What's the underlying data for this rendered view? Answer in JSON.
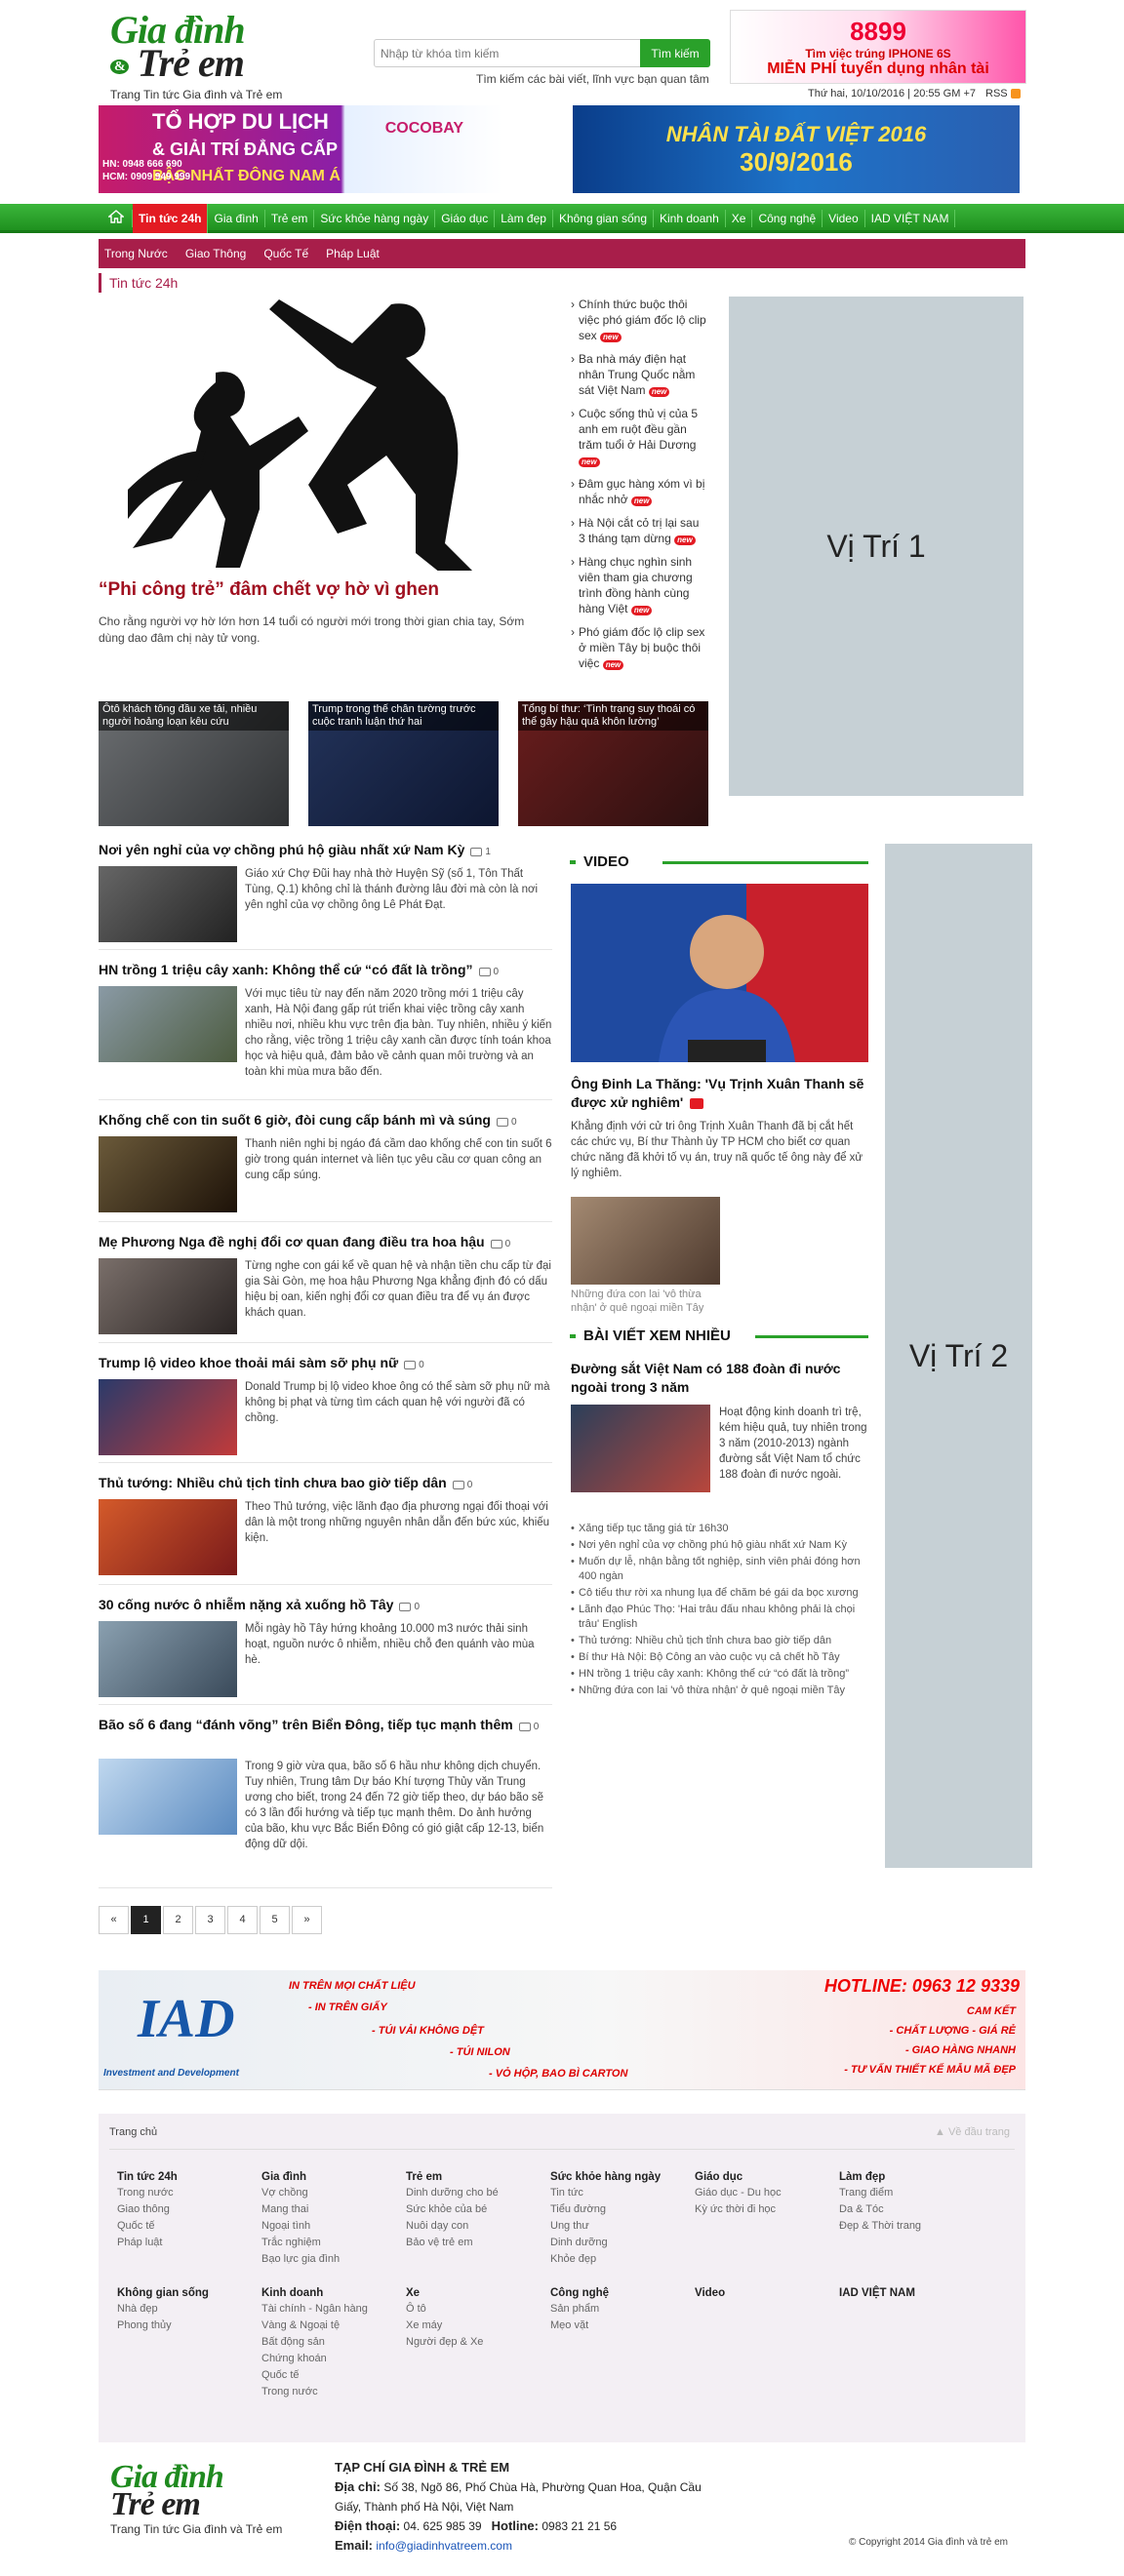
{
  "header": {
    "logo_line1": "Gia đình",
    "logo_amp": "&",
    "logo_line2": "Trẻ em",
    "tagline": "Trang Tin tức Gia đình và Trẻ em",
    "search_placeholder": "Nhập từ khóa tìm kiếm",
    "search_button": "Tìm kiếm",
    "search_hint": "Tìm kiếm các bài viết, lĩnh vực bạn quan tâm",
    "date": "Thứ hai, 10/10/2016 | 20:55 GM +7",
    "rss": "RSS"
  },
  "ads": {
    "top_right_line1": "8899",
    "top_right_line2": "Tìm việc trúng IPHONE 6S",
    "top_right_line3": "MIỄN PHÍ tuyển dụng nhân tài",
    "left_line1": "TỔ HỢP DU LỊCH",
    "left_line2": "& GIẢI TRÍ ĐẲNG CẤP",
    "left_line3": "BẬC NHẤT ĐÔNG NAM Á",
    "left_brand": "COCOBAY",
    "left_hn": "HN: 0948 666 690",
    "left_hcm": "HCM: 0909 949 999",
    "right_line1": "NHÂN TÀI ĐẤT VIỆT 2016",
    "right_line2": "30/9/2016",
    "bottom_brand": "IAD",
    "bottom_sub": "Investment and Development",
    "bottom_hotline": "HOTLINE: 0963 12 9339",
    "bottom_l1": "IN TRÊN MỌI CHẤT LIỆU",
    "bottom_l2": "- IN TRÊN GIẤY",
    "bottom_l3": "- TÚI VẢI KHÔNG DỆT",
    "bottom_l4": "- TÚI NILON",
    "bottom_l5": "- VỎ HỘP, BAO BÌ CARTON",
    "bottom_r1": "CAM KẾT",
    "bottom_r2": "- CHẤT LƯỢNG - GIÁ RẺ",
    "bottom_r3": "- GIAO HÀNG NHANH",
    "bottom_r4": "- TƯ VẤN THIẾT KẾ MẪU MÃ ĐẸP"
  },
  "nav": {
    "home_icon": "home-icon",
    "items": [
      "Tin tức 24h",
      "Gia đình",
      "Trẻ em",
      "Sức khỏe hàng ngày",
      "Giáo dục",
      "Làm đẹp",
      "Không gian sống",
      "Kinh doanh",
      "Xe",
      "Công nghệ",
      "Video",
      "IAD VIỆT NAM"
    ],
    "sub_items": [
      "Trong Nước",
      "Giao Thông",
      "Quốc Tế",
      "Pháp Luật"
    ]
  },
  "section_title": "Tin tức 24h",
  "hero": {
    "title": "“Phi công trẻ” đâm chết vợ hờ vì ghen",
    "desc": "Cho rằng người vợ hờ lớn hơn 14 tuổi có người mới trong thời gian chia tay, Sớm dùng dao đâm chị này tử vong."
  },
  "hot_list": [
    "Chính thức buộc thôi việc phó giám đốc lộ clip sex",
    "Ba nhà máy điện hạt nhân Trung Quốc nằm sát Việt Nam",
    "Cuộc sống thủ vị của 5 anh em ruột đều gần trăm tuổi ở Hải Dương",
    "Đâm gục hàng xóm vì bị nhắc nhở",
    "Hà Nội cắt cỏ trị lại sau 3 tháng tạm dừng",
    "Hàng chục nghìn sinh viên tham gia chương trình đồng hành cùng hàng Việt",
    "Phó giám đốc lộ clip sex ở miền Tây bị buộc thôi việc"
  ],
  "new_label": "new",
  "pos1": "Vị Trí 1",
  "pos2": "Vị Trí 2",
  "thumbs": [
    "Ôtô khách tông đầu xe tải, nhiều người hoảng loạn kêu cứu",
    "Trump trong thế chân tường trước cuộc tranh luận thứ hai",
    "Tổng bí thư: ‘Tình trạng suy thoái có thể gây hậu quả khôn lường’"
  ],
  "articles": [
    {
      "title": "Nơi yên nghỉ của vợ chồng phú hộ giàu nhất xứ Nam Kỳ",
      "comments": "1",
      "desc": "Giáo xứ Chợ Đũi hay nhà thờ Huyện Sỹ (số 1, Tôn Thất Tùng, Q.1) không chỉ là thánh đường lâu đời mà còn là nơi yên nghỉ của vợ chồng ông Lê Phát Đạt."
    },
    {
      "title": "HN trồng 1 triệu cây xanh: Không thể cứ “có đất là trồng”",
      "comments": "0",
      "desc": "Với mục tiêu từ nay đến năm 2020 trồng mới 1 triệu cây xanh, Hà Nội đang gấp rút triển khai việc trồng cây xanh nhiều nơi, nhiều khu vực trên địa bàn. Tuy nhiên, nhiều ý kiến cho rằng, việc trồng 1 triệu cây xanh cần được tính toán khoa học và hiệu quả, đảm bảo về cảnh quan môi trường và an toàn khi mùa mưa bão đến."
    },
    {
      "title": "Khống chế con tin suốt 6 giờ, đòi cung cấp bánh mì và súng",
      "comments": "0",
      "desc": "Thanh niên nghi bị ngáo đá cầm dao khống chế con tin suốt 6 giờ trong quán internet và liên tục yêu cầu cơ quan công an cung cấp súng."
    },
    {
      "title": "Mẹ Phương Nga đề nghị đổi cơ quan đang điều tra hoa hậu",
      "comments": "0",
      "desc": "Từng nghe con gái kể về quan hệ và nhận tiền chu cấp từ đại gia Sài Gòn, mẹ hoa hậu Phương Nga khẳng định đó có dấu hiệu bị oan, kiến nghị đổi cơ quan điều tra để vụ án được khách quan."
    },
    {
      "title": "Trump lộ video khoe thoải mái sàm sỡ phụ nữ",
      "comments": "0",
      "desc": "Donald Trump bị lộ video khoe ông có thể sàm sỡ phụ nữ mà không bị phạt và từng tìm cách quan hệ với người đã có chồng."
    },
    {
      "title": "Thủ tướng: Nhiều chủ tịch tỉnh chưa bao giờ tiếp dân",
      "comments": "0",
      "desc": "Theo Thủ tướng, việc lãnh đạo địa phương ngại đối thoại với dân là một trong những nguyên nhân dẫn đến bức xúc, khiếu kiện."
    },
    {
      "title": "30 cống nước ô nhiễm nặng xả xuống hồ Tây",
      "comments": "0",
      "desc": "Mỗi ngày hồ Tây hứng khoảng 10.000 m3 nước thải sinh hoạt, nguồn nước ô nhiễm, nhiều chỗ đen quánh vào mùa hè."
    },
    {
      "title": "Bão số 6 đang “đánh võng” trên Biển Đông, tiếp tục mạnh thêm",
      "comments": "0",
      "desc": "Trong 9 giờ vừa qua, bão số 6 hầu như không dịch chuyển. Tuy nhiên, Trung tâm Dự báo Khí tượng Thủy văn Trung ương cho biết, trong 24 đến 72 giờ tiếp theo, dự báo bão sẽ có 3 lần đổi hướng và tiếp tục mạnh thêm. Do ảnh hưởng của bão, khu vực Bắc Biển Đông có gió giật cấp 12-13, biển động dữ dội."
    }
  ],
  "pager": [
    "«",
    "1",
    "2",
    "3",
    "4",
    "5",
    "»"
  ],
  "video": {
    "heading": "VIDEO",
    "title": "Ông Đinh La Thăng: 'Vụ Trịnh Xuân Thanh sẽ được xử nghiêm'",
    "desc": "Khẳng định với cử tri ông Trịnh Xuân Thanh đã bị cắt hết các chức vụ, Bí thư Thành ủy TP HCM cho biết cơ quan chức năng đã khởi tố vụ án, truy nã quốc tế ông này để xử lý nghiêm.",
    "caption2": "Những đứa con lai 'vô thừa nhận' ở quê ngoại miền Tây"
  },
  "related": {
    "heading": "BÀI VIẾT XEM NHIỀU",
    "title": "Đường sắt Việt Nam có 188 đoàn đi nước ngoài trong 3 năm",
    "desc": "Hoạt động kinh doanh trì trệ, kém hiệu quả, tuy nhiên trong 3 năm (2010-2013) ngành đường sắt Việt Nam tổ chức 188 đoàn đi nước ngoài.",
    "list": [
      "Xăng tiếp tục tăng giá từ 16h30",
      "Nơi yên nghỉ của vợ chồng phú hộ giàu nhất xứ Nam Kỳ",
      "Muốn dự lễ, nhận bằng tốt nghiệp, sinh viên phải đóng hơn 400 ngàn",
      "Cô tiểu thư rời xa nhung lụa để chăm bé gái da bọc xương",
      "Lãnh đạo Phúc Thọ: 'Hai trâu đấu nhau không phải là chọi trâu' English",
      "Thủ tướng: Nhiều chủ tịch tỉnh chưa bao giờ tiếp dân",
      "Bí thư Hà Nội: Bộ Công an vào cuộc vụ cả chết hồ Tây",
      "HN trồng 1 triệu cây xanh: Không thể cứ “có đất là trồng”",
      "Những đứa con lai 'vô thừa nhận' ở quê ngoại miền Tây"
    ]
  },
  "footer": {
    "home": "Trang chủ",
    "back_top": "Về đầu trang",
    "cols": [
      {
        "title": "Tin tức 24h",
        "items": [
          "Trong nước",
          "Giao thông",
          "Quốc tế",
          "Pháp luật"
        ]
      },
      {
        "title": "Gia đình",
        "items": [
          "Vợ chồng",
          "Mang thai",
          "Ngoại tình",
          "Trắc nghiệm",
          "Bạo lực gia đình"
        ]
      },
      {
        "title": "Trẻ em",
        "items": [
          "Dinh dưỡng cho bé",
          "Sức khỏe của bé",
          "Nuôi dạy con",
          "Bảo vệ trẻ em"
        ]
      },
      {
        "title": "Sức khỏe hàng ngày",
        "items": [
          "Tin tức",
          "Tiểu đường",
          "Ung thư",
          "Dinh dưỡng",
          "Khỏe đẹp"
        ]
      },
      {
        "title": "Giáo dục",
        "items": [
          "Giáo dục - Du học",
          "Kỳ ức thời đi học"
        ]
      },
      {
        "title": "Làm đẹp",
        "items": [
          "Trang điểm",
          "Da & Tóc",
          "Đẹp & Thời trang"
        ]
      },
      {
        "title": "Không gian sống",
        "items": [
          "Nhà đẹp",
          "Phong thủy"
        ]
      },
      {
        "title": "Kinh doanh",
        "items": [
          "Tài chính - Ngân hàng",
          "Vàng & Ngoại tệ",
          "Bất động sản",
          "Chứng khoán",
          "Quốc tế",
          "Trong nước"
        ]
      },
      {
        "title": "Xe",
        "items": [
          "Ô tô",
          "Xe máy",
          "Người đẹp & Xe"
        ]
      },
      {
        "title": "Công nghệ",
        "items": [
          "Sản phẩm",
          "Mẹo vặt"
        ]
      },
      {
        "title": "Video",
        "items": []
      },
      {
        "title": "IAD VIỆT NAM",
        "items": []
      }
    ],
    "mag_title": "TẠP CHÍ GIA ĐÌNH & TRẺ EM",
    "addr_label": "Địa chỉ:",
    "addr": "Số 38, Ngõ 86, Phố Chùa Hà, Phường Quan Hoa, Quận Cầu Giấy, Thành phố Hà Nội, Việt Nam",
    "phone_label": "Điện thoại:",
    "phone": "04. 625 985 39",
    "hotline_label": "Hotline:",
    "hotline": "0983 21 21 56",
    "email_label": "Email:",
    "email": "info@giadinhvatreem.com",
    "copyright": "© Copyright 2014 Gia đình và trẻ em"
  }
}
